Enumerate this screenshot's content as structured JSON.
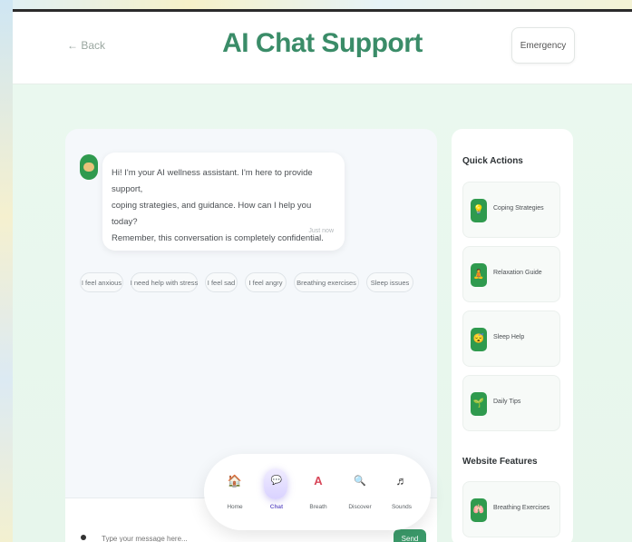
{
  "header": {
    "back_label": "← Back",
    "title": "AI Chat Support",
    "emergency_label": "Emergency"
  },
  "chat": {
    "message_lines": [
      "Hi! I'm your AI wellness assistant. I'm here to provide support,",
      "coping strategies, and guidance. How can I help you today?",
      "Remember, this conversation is completely confidential."
    ],
    "message_time": "Just now",
    "quick_replies": [
      "I feel anxious",
      "I need help with stress",
      "I feel sad",
      "I feel angry",
      "Breathing exercises",
      "Sleep issues"
    ],
    "input_placeholder": "Type your message here...",
    "send_label": "Send"
  },
  "bottom_nav": {
    "items": [
      {
        "label": "Home",
        "icon": "home-icon",
        "glyph": "🏠"
      },
      {
        "label": "Chat",
        "icon": "chat-icon",
        "glyph": "💬"
      },
      {
        "label": "Breath",
        "icon": "breath-icon",
        "glyph": "A"
      },
      {
        "label": "Discover",
        "icon": "search-icon",
        "glyph": "🔍"
      },
      {
        "label": "Sounds",
        "icon": "music-icon",
        "glyph": "♬"
      }
    ],
    "active": "Chat"
  },
  "sidebar": {
    "quick_actions_heading": "Quick Actions",
    "quick_actions": [
      {
        "label": "Coping Strategies",
        "icon": "lightbulb-icon",
        "glyph": "💡"
      },
      {
        "label": "Relaxation Guide",
        "icon": "meditation-icon",
        "glyph": "🧘"
      },
      {
        "label": "Sleep Help",
        "icon": "sleep-icon",
        "glyph": "😴"
      },
      {
        "label": "Daily Tips",
        "icon": "tips-icon",
        "glyph": "🌱"
      }
    ],
    "website_features_heading": "Website Features",
    "website_features": [
      {
        "label": "Breathing Exercises",
        "icon": "breathing-icon",
        "glyph": "🫁"
      }
    ]
  },
  "colors": {
    "brand_green": "#3a8c68",
    "background": "#e9f6ee",
    "active_nav": "#6e5fc9"
  }
}
